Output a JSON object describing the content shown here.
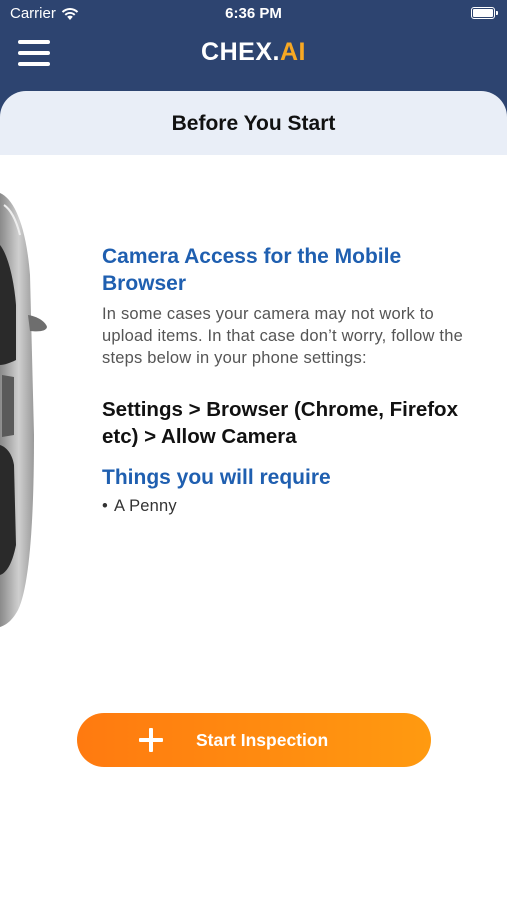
{
  "status_bar": {
    "carrier": "Carrier",
    "time": "6:36 PM"
  },
  "header": {
    "logo_main": "CHEX.",
    "logo_accent": "AI",
    "menu_icon": "hamburger-menu-icon"
  },
  "section": {
    "title": "Before You Start"
  },
  "camera_access": {
    "title": "Camera Access for the Mobile Browser",
    "description": "In some cases your camera may not work to upload items. In that case don’t worry, follow the steps below in your phone settings:",
    "settings_path": "Settings > Browser (Chrome, Firefox etc) > Allow Camera"
  },
  "requirements": {
    "title": "Things you will require",
    "items": [
      "A Penny"
    ]
  },
  "actions": {
    "start_label": "Start Inspection",
    "start_icon": "plus-icon"
  },
  "colors": {
    "header_bg": "#2d4470",
    "logo_accent": "#f7a823",
    "title_card_bg": "#e9eef7",
    "heading_blue": "#1f5fb0",
    "button_start": "#ff7a10",
    "button_end": "#ff9a10"
  }
}
